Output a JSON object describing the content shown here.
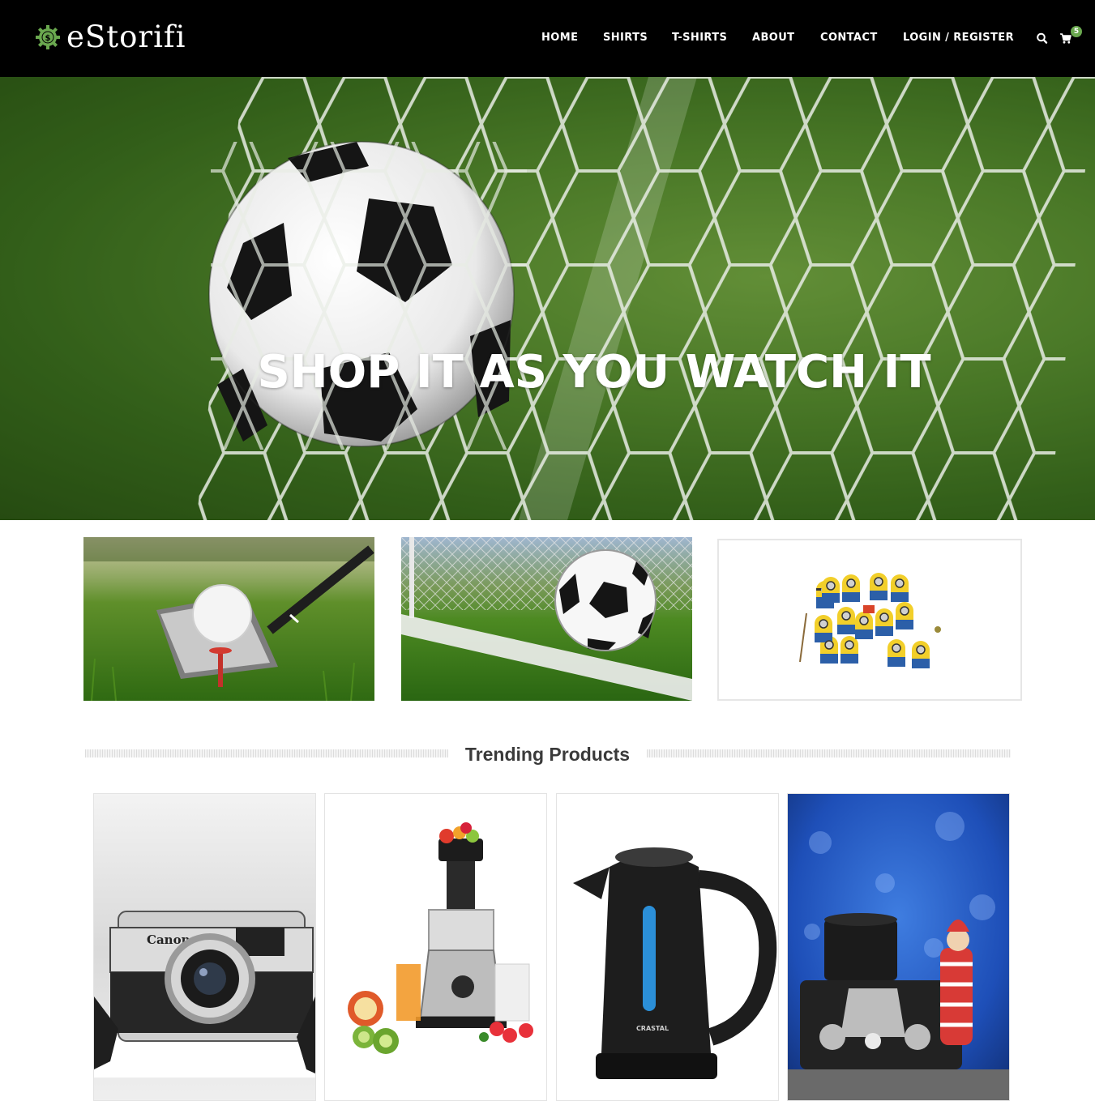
{
  "header": {
    "logo_text": "eStorifi",
    "logo_icon": "dollar-gear-icon",
    "nav": [
      {
        "label": "HOME"
      },
      {
        "label": "SHIRTS"
      },
      {
        "label": "T-SHIRTS"
      },
      {
        "label": "ABOUT"
      },
      {
        "label": "CONTACT"
      },
      {
        "label": "LOGIN / REGISTER"
      }
    ],
    "search_icon": "search-icon",
    "cart_icon": "cart-icon",
    "cart_count": "5"
  },
  "hero": {
    "title": "SHOP IT AS YOU WATCH IT",
    "image": "soccer-ball-in-net"
  },
  "banners": [
    {
      "image": "golf-ball-and-club"
    },
    {
      "image": "soccer-ball-on-pitch"
    },
    {
      "image": "minion-toys"
    }
  ],
  "trending": {
    "title": "Trending Products",
    "products": [
      {
        "image": "canon-camera"
      },
      {
        "image": "juicer-with-fruit"
      },
      {
        "image": "black-kettle"
      },
      {
        "image": "camera-with-toy"
      }
    ]
  },
  "colors": {
    "header_bg": "#000000",
    "accent": "#6aa84f",
    "hero_green": "#4f7d2a"
  }
}
